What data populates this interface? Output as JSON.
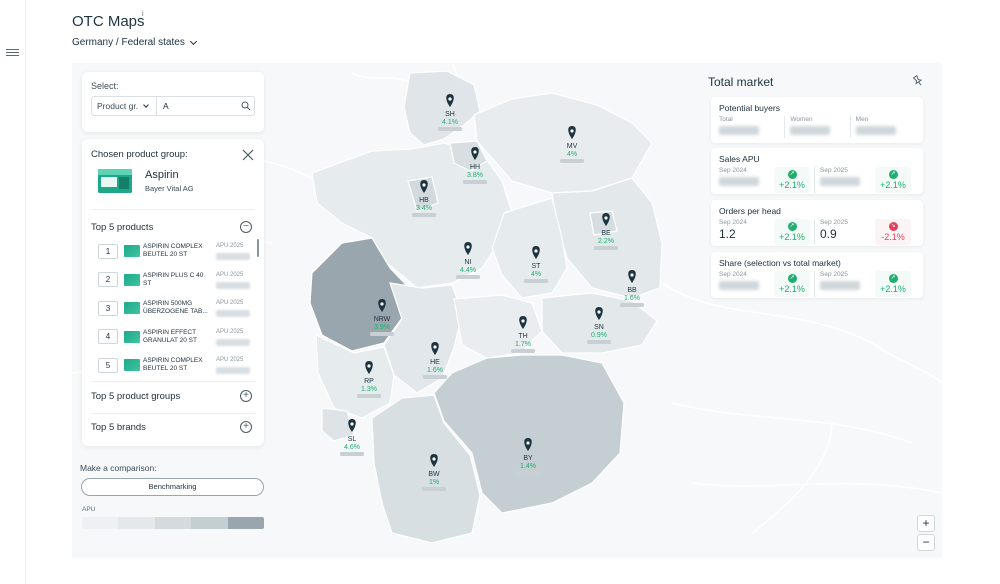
{
  "app": {
    "title": "OTC Maps",
    "breadcrumb": "Germany / Federal states"
  },
  "select": {
    "label": "Select:",
    "dropdown": "Product gr.",
    "input_value": "A"
  },
  "chosen": {
    "label": "Chosen product group:",
    "name": "Aspirin",
    "manufacturer": "Bayer Vital AG"
  },
  "top_products": {
    "title": "Top 5 products",
    "column": "APU 2025",
    "items": [
      {
        "rank": "1",
        "name": "ASPIRIN COMPLEX BEUTEL 20 ST"
      },
      {
        "rank": "2",
        "name": "ASPIRIN PLUS C 40 ST"
      },
      {
        "rank": "3",
        "name": "ASPIRIN 500MG ÜBERZOGENE TAB..."
      },
      {
        "rank": "4",
        "name": "ASPIRIN EFFECT GRANULAT 20 ST"
      },
      {
        "rank": "5",
        "name": "ASPIRIN COMPLEX BEUTEL 20 ST"
      }
    ]
  },
  "sections": {
    "product_groups": "Top 5 product groups",
    "brands": "Top 5 brands"
  },
  "comparison": {
    "label": "Make a comparison:",
    "button": "Benchmarking",
    "legend_label": "APU"
  },
  "market": {
    "title": "Total market",
    "potential": {
      "title": "Potential buyers",
      "total": "Total",
      "women": "Women",
      "men": "Men"
    },
    "sales": {
      "title": "Sales APU",
      "p1": "Sep 2024",
      "p2": "Sep 2025",
      "d1": "+2.1%",
      "d2": "+2.1%"
    },
    "orders": {
      "title": "Orders per head",
      "p1": "Sep 2024",
      "p2": "Sep 2025",
      "v1": "1.2",
      "v2": "0.9",
      "d1": "+2.1%",
      "d2": "-2.1%"
    },
    "share": {
      "title": "Share (selection vs total market)",
      "p1": "Sep 2024",
      "p2": "Sep 2025",
      "d1": "+2.1%",
      "d2": "+2.1%"
    }
  },
  "regions": [
    {
      "code": "SH",
      "pct": "4.1%"
    },
    {
      "code": "HH",
      "pct": "3.8%"
    },
    {
      "code": "MV",
      "pct": "4%"
    },
    {
      "code": "HB",
      "pct": "3.4%"
    },
    {
      "code": "NI",
      "pct": "4.4%"
    },
    {
      "code": "BE",
      "pct": "2.2%"
    },
    {
      "code": "ST",
      "pct": "4%"
    },
    {
      "code": "BB",
      "pct": "1.6%"
    },
    {
      "code": "NRW",
      "pct": "3.9%"
    },
    {
      "code": "SN",
      "pct": "0.9%"
    },
    {
      "code": "TH",
      "pct": "1.7%"
    },
    {
      "code": "HE",
      "pct": "1.6%"
    },
    {
      "code": "RP",
      "pct": "1.3%"
    },
    {
      "code": "SL",
      "pct": "4.6%"
    },
    {
      "code": "BY",
      "pct": "1.4%"
    },
    {
      "code": "BW",
      "pct": "1%"
    }
  ],
  "zoom": {
    "in": "+",
    "out": "−"
  },
  "colors": {
    "accent": "#1fae6f",
    "negative": "#e0435a",
    "pin": "#1d3440",
    "highlight_region": "#9aa6ad"
  }
}
